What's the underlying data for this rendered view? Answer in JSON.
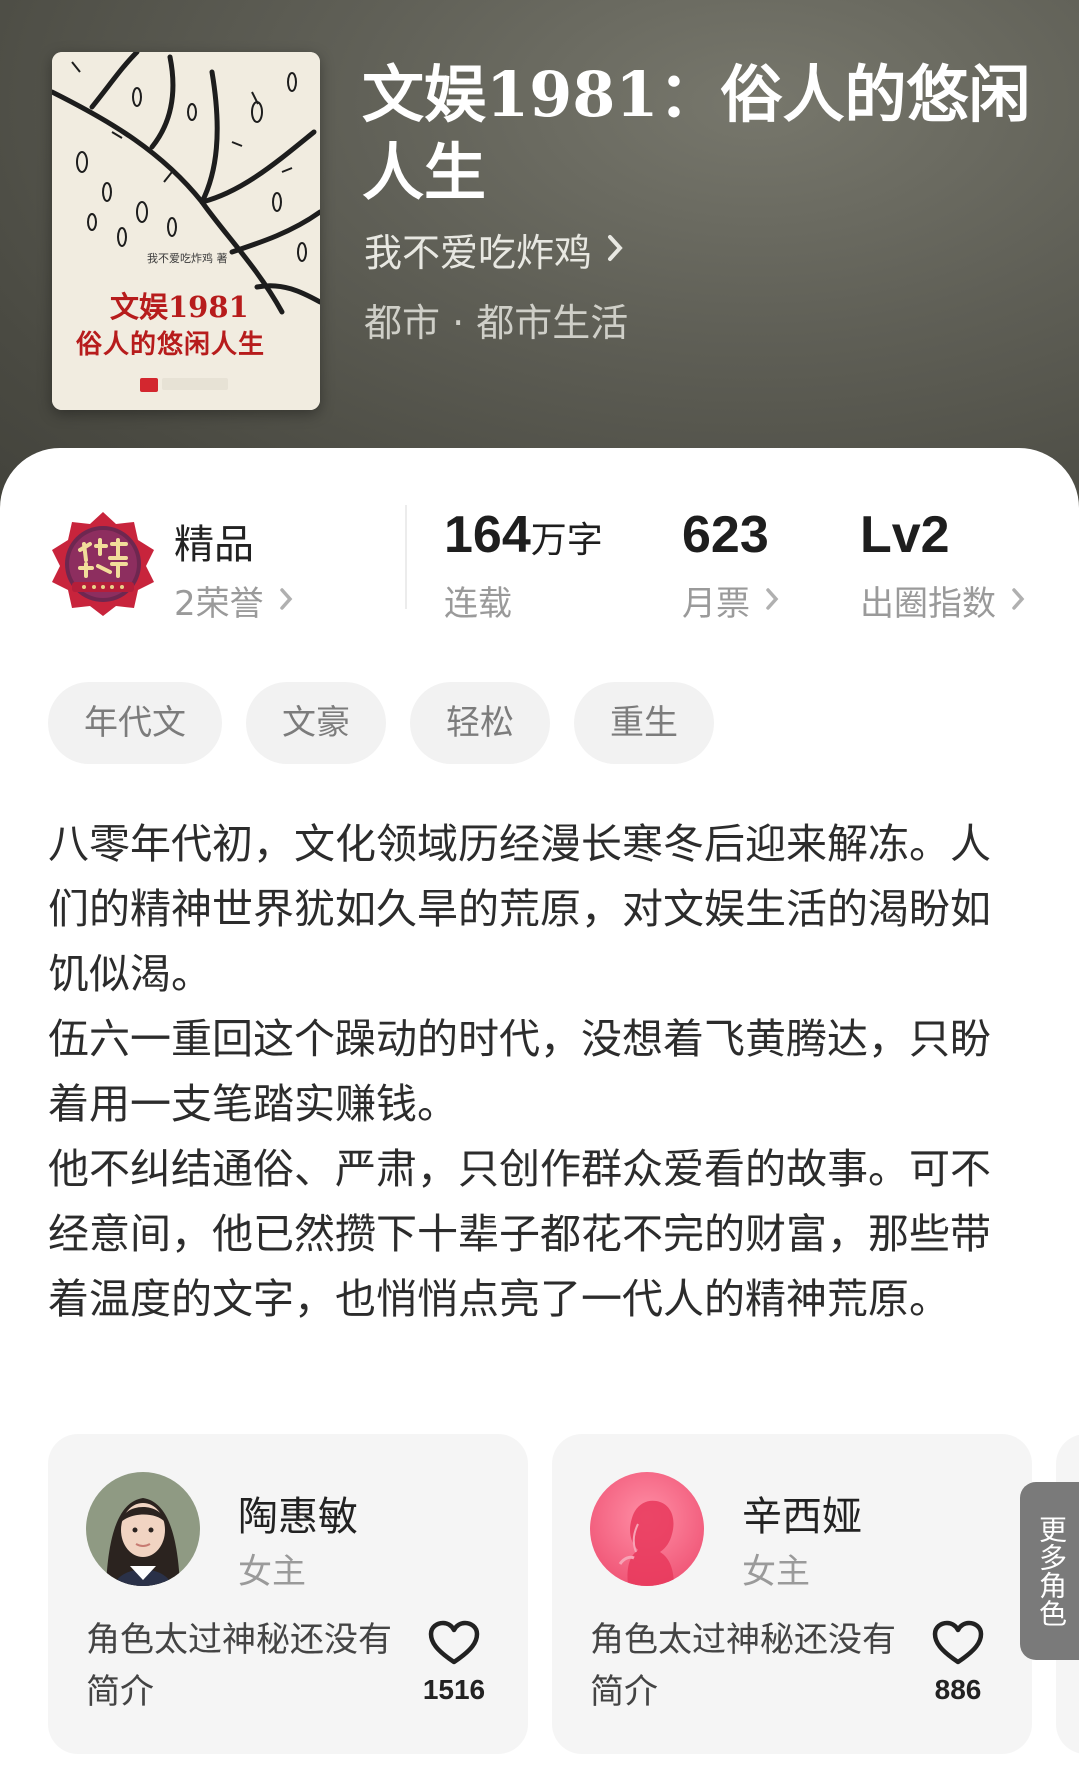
{
  "book": {
    "title": "文娱1981：俗人的悠闲人生",
    "author": "我不爱吃炸鸡",
    "genre": "都市 · 都市生活",
    "cover": {
      "author_line": "我不爱吃炸鸡 著",
      "title_line1": "文娱1981",
      "title_line2": "俗人的悠闲人生"
    }
  },
  "stats": {
    "quality": {
      "label": "精品",
      "honors": "2荣誉"
    },
    "words": {
      "value": "164",
      "unit": "万字",
      "status": "连载"
    },
    "tickets": {
      "value": "623",
      "label": "月票"
    },
    "index": {
      "value": "Lv2",
      "label": "出圈指数"
    }
  },
  "tags": [
    "年代文",
    "文豪",
    "轻松",
    "重生"
  ],
  "description": [
    "八零年代初，文化领域历经漫长寒冬后迎来解冻。人们的精神世界犹如久旱的荒原，对文娱生活的渴盼如饥似渴。",
    "伍六一重回这个躁动的时代，没想着飞黄腾达，只盼着用一支笔踏实赚钱。",
    "他不纠结通俗、严肃，只创作群众爱看的故事。可不经意间，他已然攒下十辈子都花不完的财富，那些带着温度的文字，也悄悄点亮了一代人的精神荒原。"
  ],
  "characters": [
    {
      "name": "陶惠敏",
      "role": "女主",
      "intro": "角色太过神秘还没有简介",
      "likes": "1516"
    },
    {
      "name": "辛西娅",
      "role": "女主",
      "intro": "角色太过神秘还没有简介",
      "likes": "886"
    }
  ],
  "more_roles": "更多角色",
  "colors": {
    "accent_red": "#b71c1c",
    "header_bg": "#5a5a52"
  }
}
